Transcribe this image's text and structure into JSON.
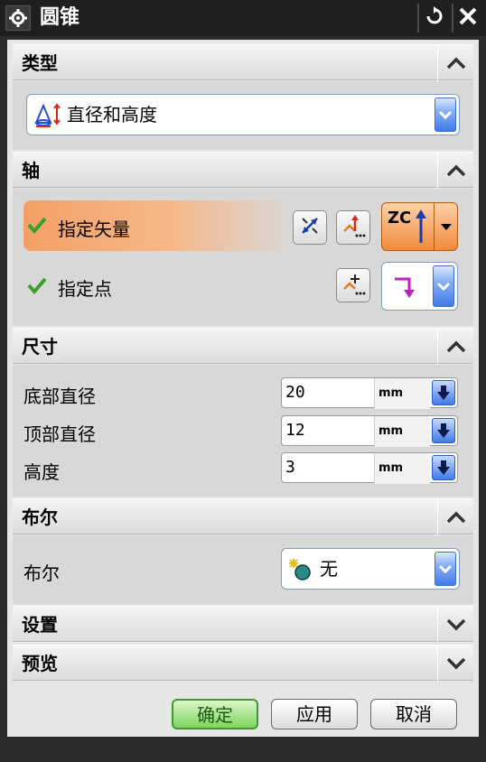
{
  "window": {
    "title": "圆锥",
    "title_icon": "gear-icon"
  },
  "sections": {
    "type": {
      "title": "类型",
      "collapsed": false,
      "dropdown_value": "直径和高度",
      "dropdown_icon": "cone-diameter-height-icon"
    },
    "axis": {
      "title": "轴",
      "collapsed": false,
      "specify_vector_label": "指定矢量",
      "specify_point_label": "指定点",
      "vector_dropdown_text": "ZC",
      "status": "check-icon"
    },
    "dimensions": {
      "title": "尺寸",
      "collapsed": false,
      "fields": [
        {
          "label": "底部直径",
          "value": "20",
          "unit": "mm"
        },
        {
          "label": "顶部直径",
          "value": "12",
          "unit": "mm"
        },
        {
          "label": "高度",
          "value": "3",
          "unit": "mm"
        }
      ]
    },
    "boolean": {
      "title": "布尔",
      "collapsed": false,
      "label": "布尔",
      "value": "无"
    },
    "settings": {
      "title": "设置",
      "collapsed": true
    },
    "preview": {
      "title": "预览",
      "collapsed": true
    }
  },
  "buttons": {
    "ok": "确定",
    "apply": "应用",
    "cancel": "取消"
  },
  "colors": {
    "accent_orange": "#f08a3c",
    "check_green": "#3aa02a",
    "dropdown_blue": "#3f7be8",
    "title_bar": "#1f1f1f"
  }
}
